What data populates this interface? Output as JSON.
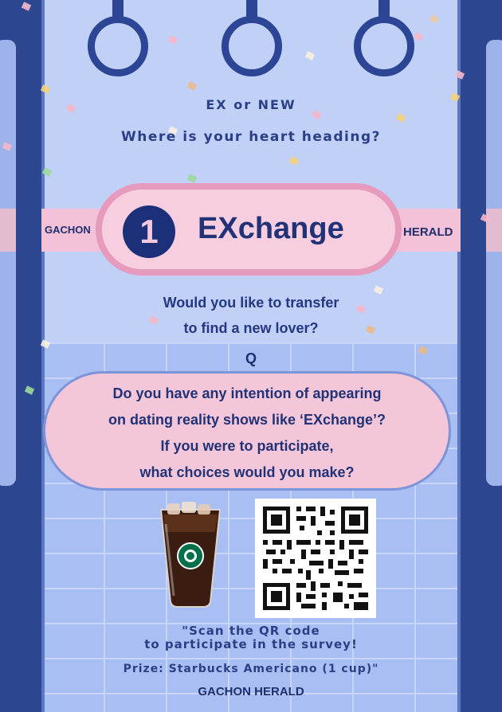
{
  "header": {
    "line1": "EX or NEW",
    "line2": "Where is your heart heading?"
  },
  "station": {
    "left_label": "GACHON",
    "right_label": "HERALD",
    "number": "1",
    "name": "EXchange"
  },
  "prompt": {
    "line1": "Would you like to transfer",
    "line2": "to find a new lover?"
  },
  "question": {
    "label": "Q",
    "line1": "Do you have any intention of appearing",
    "line2": "on dating reality shows like ‘EXchange’?",
    "line3": "If you were to participate,",
    "line4": "what choices would you make?"
  },
  "survey": {
    "scan_line1": "\"Scan the QR code",
    "scan_line2": "to participate in the survey!",
    "prize": "Prize: Starbucks Americano (1 cup)\""
  },
  "footer": {
    "publisher": "GACHON HERALD"
  },
  "icons": {
    "cup": "iced-americano-icon",
    "qr": "qr-code-icon",
    "rings": "hand-ring-icon"
  },
  "colors": {
    "navy": "#27408e",
    "panel": "#c0d0f7",
    "pink": "#f3c2d8",
    "pink_border": "#e69bbd"
  }
}
